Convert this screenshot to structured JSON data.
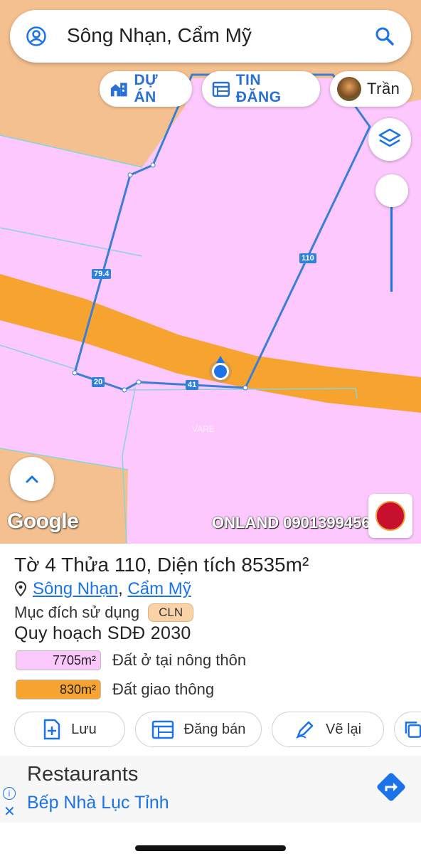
{
  "search": {
    "query": "Sông Nhạn, Cẩm Mỹ"
  },
  "chips": {
    "project_label": "DỰ ÁN",
    "listing_label": "TIN ĐĂNG",
    "user_label": "Trần"
  },
  "map": {
    "edge_labels": [
      "79.4",
      "110",
      "20",
      "41"
    ],
    "google_logo": "Google",
    "watermark": "ONLAND 0901399456",
    "faint_mark": "VARE"
  },
  "parcel": {
    "title": "Tờ 4 Thửa 110, Diện tích 8535m²",
    "location_commune": "Sông Nhạn",
    "location_sep": ",",
    "location_district": "Cẩm Mỹ",
    "purpose_label": "Mục đích sử dụng",
    "purpose_code": "CLN",
    "plan_title": "Quy hoạch SDĐ 2030",
    "zones": [
      {
        "area": "7705m²",
        "name": "Đất ở tại nông thôn",
        "color": "#fbc8fb"
      },
      {
        "area": "830m²",
        "name": "Đất giao thông",
        "color": "#f7a330"
      }
    ]
  },
  "actions": {
    "save_label": "Lưu",
    "post_label": "Đăng bán",
    "redraw_label": "Vẽ lại"
  },
  "ad": {
    "heading": "Restaurants",
    "name": "Bếp Nhà Lục Tỉnh"
  },
  "colors": {
    "residential": "#fbc8fb",
    "agricultural": "#f5c08f",
    "road": "#f7a330",
    "boundary": "#3a7fd5",
    "accent": "#1a73e8"
  }
}
